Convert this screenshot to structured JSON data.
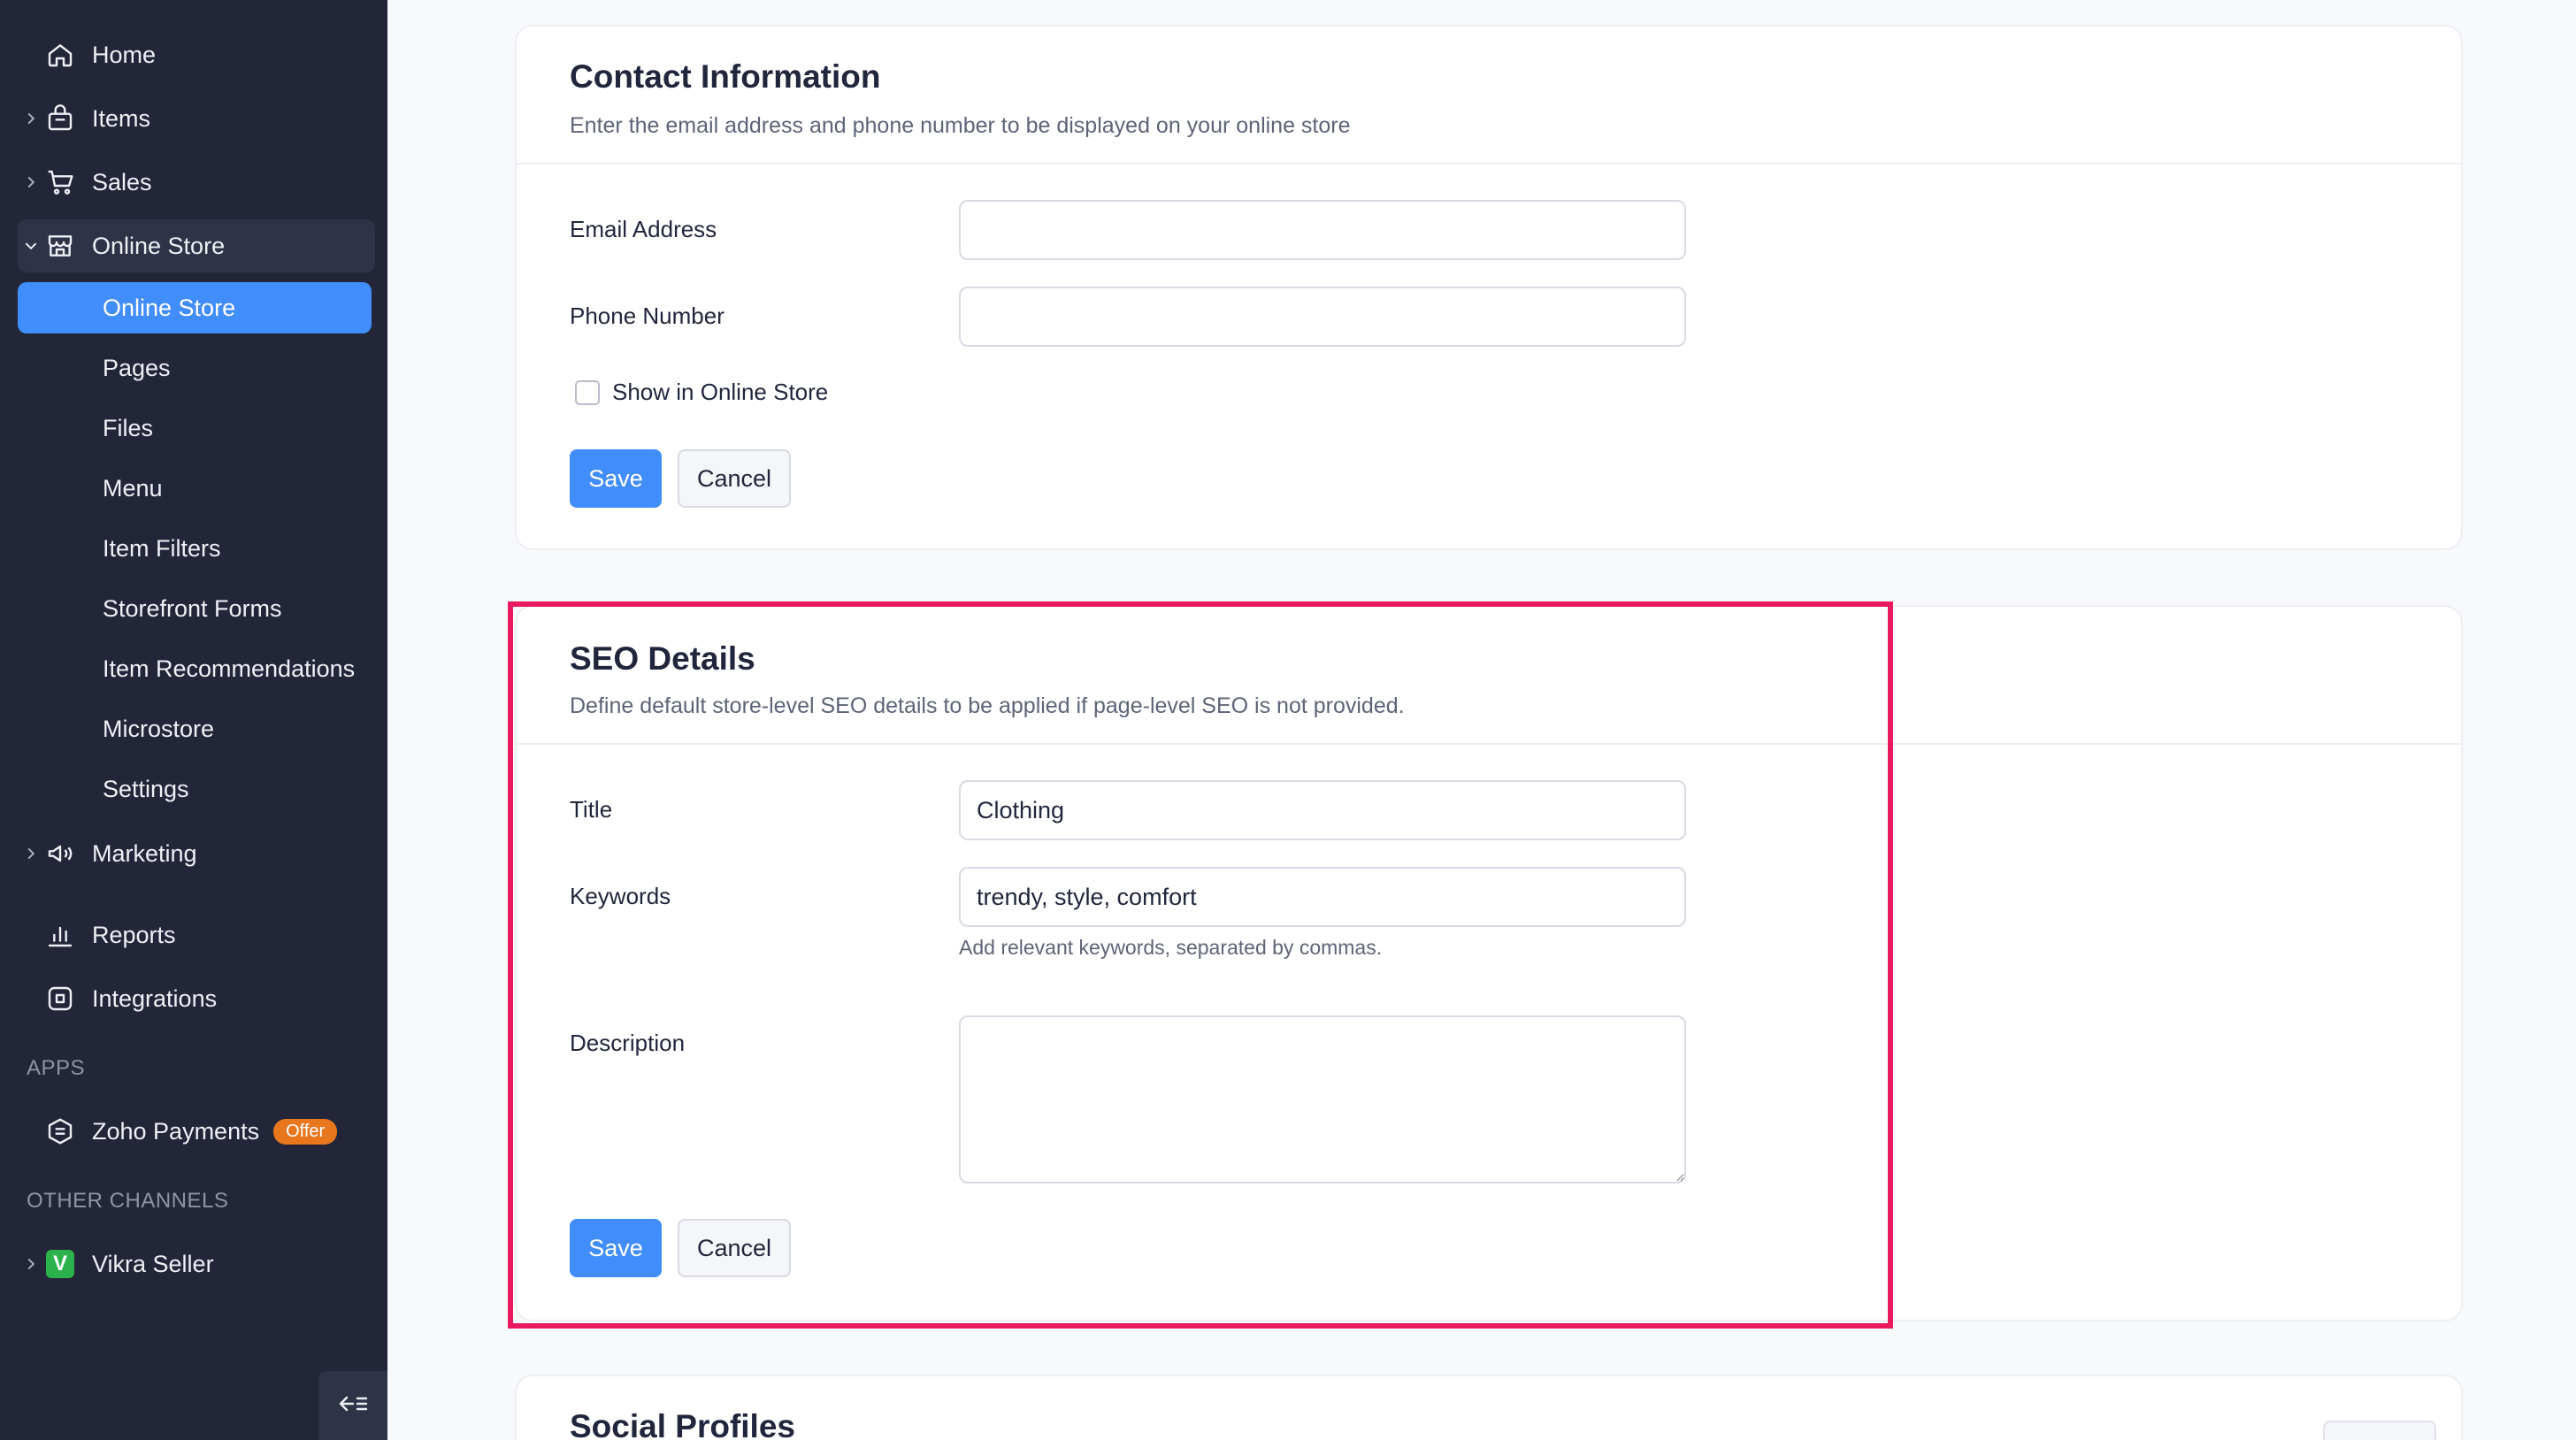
{
  "sidebar": {
    "items": [
      {
        "label": "Home",
        "icon": "home-icon"
      },
      {
        "label": "Items",
        "icon": "basket-icon"
      },
      {
        "label": "Sales",
        "icon": "cart-icon"
      },
      {
        "label": "Online Store",
        "icon": "store-icon"
      },
      {
        "label": "Marketing",
        "icon": "megaphone-icon"
      },
      {
        "label": "Reports",
        "icon": "bar-chart-icon"
      },
      {
        "label": "Integrations",
        "icon": "integrations-icon"
      }
    ],
    "online_store_subitems": [
      "Online Store",
      "Pages",
      "Files",
      "Menu",
      "Item Filters",
      "Storefront Forms",
      "Item Recommendations",
      "Microstore",
      "Settings"
    ],
    "apps_label": "APPS",
    "apps": [
      {
        "label": "Zoho Payments",
        "badge": "Offer",
        "icon": "zoho-payments-icon"
      }
    ],
    "other_channels_label": "OTHER CHANNELS",
    "channels": [
      {
        "label": "Vikra Seller",
        "logo_letter": "V",
        "icon": "vikra-logo-icon"
      }
    ],
    "colors": {
      "background": "#232638",
      "active": "#408dfb",
      "badge": "#e8761c"
    }
  },
  "contact": {
    "title": "Contact Information",
    "description": "Enter the email address and phone number to be displayed on your online store",
    "email_label": "Email Address",
    "email_value": "",
    "phone_label": "Phone Number",
    "phone_value": "",
    "show_label": "Show in Online Store",
    "show_checked": false,
    "save_label": "Save",
    "cancel_label": "Cancel"
  },
  "seo": {
    "title": "SEO Details",
    "description": "Define default store-level SEO details to be applied if page-level SEO is not provided.",
    "title_label": "Title",
    "title_value": "Clothing",
    "keywords_label": "Keywords",
    "keywords_value": "trendy, style, comfort",
    "keywords_hint": "Add relevant keywords, separated by commas.",
    "description_label": "Description",
    "description_value": "",
    "save_label": "Save",
    "cancel_label": "Cancel"
  },
  "social": {
    "title": "Social Profiles"
  },
  "highlight_color": "#e8195d"
}
